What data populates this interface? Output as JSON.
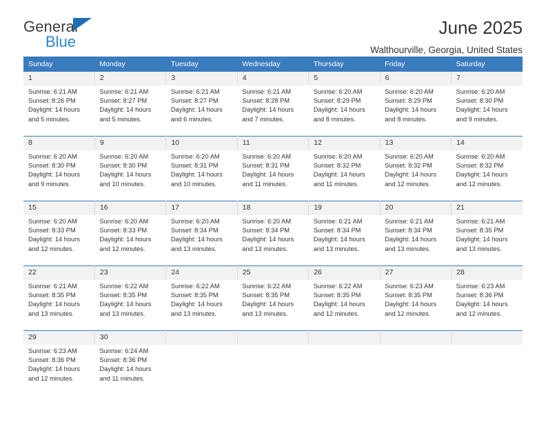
{
  "brand": {
    "word_one": "General",
    "word_two": "Blue",
    "triangle_color": "#1f6fb2",
    "blue_color": "#2b86cc"
  },
  "header": {
    "title": "June 2025",
    "subtitle": "Walthourville, Georgia, United States"
  },
  "theme": {
    "header_blue": "#3a7cbe",
    "daynum_bg": "#f2f2f2",
    "text": "#333333"
  },
  "calendar": {
    "weekday_headers": [
      "Sunday",
      "Monday",
      "Tuesday",
      "Wednesday",
      "Thursday",
      "Friday",
      "Saturday"
    ],
    "weeks": [
      [
        {
          "day": "1",
          "sunrise": "Sunrise: 6:21 AM",
          "sunset": "Sunset: 8:26 PM",
          "daylight_1": "Daylight: 14 hours",
          "daylight_2": "and 5 minutes."
        },
        {
          "day": "2",
          "sunrise": "Sunrise: 6:21 AM",
          "sunset": "Sunset: 8:27 PM",
          "daylight_1": "Daylight: 14 hours",
          "daylight_2": "and 5 minutes."
        },
        {
          "day": "3",
          "sunrise": "Sunrise: 6:21 AM",
          "sunset": "Sunset: 8:27 PM",
          "daylight_1": "Daylight: 14 hours",
          "daylight_2": "and 6 minutes."
        },
        {
          "day": "4",
          "sunrise": "Sunrise: 6:21 AM",
          "sunset": "Sunset: 8:28 PM",
          "daylight_1": "Daylight: 14 hours",
          "daylight_2": "and 7 minutes."
        },
        {
          "day": "5",
          "sunrise": "Sunrise: 6:20 AM",
          "sunset": "Sunset: 8:29 PM",
          "daylight_1": "Daylight: 14 hours",
          "daylight_2": "and 8 minutes."
        },
        {
          "day": "6",
          "sunrise": "Sunrise: 6:20 AM",
          "sunset": "Sunset: 8:29 PM",
          "daylight_1": "Daylight: 14 hours",
          "daylight_2": "and 8 minutes."
        },
        {
          "day": "7",
          "sunrise": "Sunrise: 6:20 AM",
          "sunset": "Sunset: 8:30 PM",
          "daylight_1": "Daylight: 14 hours",
          "daylight_2": "and 9 minutes."
        }
      ],
      [
        {
          "day": "8",
          "sunrise": "Sunrise: 6:20 AM",
          "sunset": "Sunset: 8:30 PM",
          "daylight_1": "Daylight: 14 hours",
          "daylight_2": "and 9 minutes."
        },
        {
          "day": "9",
          "sunrise": "Sunrise: 6:20 AM",
          "sunset": "Sunset: 8:30 PM",
          "daylight_1": "Daylight: 14 hours",
          "daylight_2": "and 10 minutes."
        },
        {
          "day": "10",
          "sunrise": "Sunrise: 6:20 AM",
          "sunset": "Sunset: 8:31 PM",
          "daylight_1": "Daylight: 14 hours",
          "daylight_2": "and 10 minutes."
        },
        {
          "day": "11",
          "sunrise": "Sunrise: 6:20 AM",
          "sunset": "Sunset: 8:31 PM",
          "daylight_1": "Daylight: 14 hours",
          "daylight_2": "and 11 minutes."
        },
        {
          "day": "12",
          "sunrise": "Sunrise: 6:20 AM",
          "sunset": "Sunset: 8:32 PM",
          "daylight_1": "Daylight: 14 hours",
          "daylight_2": "and 11 minutes."
        },
        {
          "day": "13",
          "sunrise": "Sunrise: 6:20 AM",
          "sunset": "Sunset: 8:32 PM",
          "daylight_1": "Daylight: 14 hours",
          "daylight_2": "and 12 minutes."
        },
        {
          "day": "14",
          "sunrise": "Sunrise: 6:20 AM",
          "sunset": "Sunset: 8:32 PM",
          "daylight_1": "Daylight: 14 hours",
          "daylight_2": "and 12 minutes."
        }
      ],
      [
        {
          "day": "15",
          "sunrise": "Sunrise: 6:20 AM",
          "sunset": "Sunset: 8:33 PM",
          "daylight_1": "Daylight: 14 hours",
          "daylight_2": "and 12 minutes."
        },
        {
          "day": "16",
          "sunrise": "Sunrise: 6:20 AM",
          "sunset": "Sunset: 8:33 PM",
          "daylight_1": "Daylight: 14 hours",
          "daylight_2": "and 12 minutes."
        },
        {
          "day": "17",
          "sunrise": "Sunrise: 6:20 AM",
          "sunset": "Sunset: 8:34 PM",
          "daylight_1": "Daylight: 14 hours",
          "daylight_2": "and 13 minutes."
        },
        {
          "day": "18",
          "sunrise": "Sunrise: 6:20 AM",
          "sunset": "Sunset: 8:34 PM",
          "daylight_1": "Daylight: 14 hours",
          "daylight_2": "and 13 minutes."
        },
        {
          "day": "19",
          "sunrise": "Sunrise: 6:21 AM",
          "sunset": "Sunset: 8:34 PM",
          "daylight_1": "Daylight: 14 hours",
          "daylight_2": "and 13 minutes."
        },
        {
          "day": "20",
          "sunrise": "Sunrise: 6:21 AM",
          "sunset": "Sunset: 8:34 PM",
          "daylight_1": "Daylight: 14 hours",
          "daylight_2": "and 13 minutes."
        },
        {
          "day": "21",
          "sunrise": "Sunrise: 6:21 AM",
          "sunset": "Sunset: 8:35 PM",
          "daylight_1": "Daylight: 14 hours",
          "daylight_2": "and 13 minutes."
        }
      ],
      [
        {
          "day": "22",
          "sunrise": "Sunrise: 6:21 AM",
          "sunset": "Sunset: 8:35 PM",
          "daylight_1": "Daylight: 14 hours",
          "daylight_2": "and 13 minutes."
        },
        {
          "day": "23",
          "sunrise": "Sunrise: 6:22 AM",
          "sunset": "Sunset: 8:35 PM",
          "daylight_1": "Daylight: 14 hours",
          "daylight_2": "and 13 minutes."
        },
        {
          "day": "24",
          "sunrise": "Sunrise: 6:22 AM",
          "sunset": "Sunset: 8:35 PM",
          "daylight_1": "Daylight: 14 hours",
          "daylight_2": "and 13 minutes."
        },
        {
          "day": "25",
          "sunrise": "Sunrise: 6:22 AM",
          "sunset": "Sunset: 8:35 PM",
          "daylight_1": "Daylight: 14 hours",
          "daylight_2": "and 13 minutes."
        },
        {
          "day": "26",
          "sunrise": "Sunrise: 6:22 AM",
          "sunset": "Sunset: 8:35 PM",
          "daylight_1": "Daylight: 14 hours",
          "daylight_2": "and 12 minutes."
        },
        {
          "day": "27",
          "sunrise": "Sunrise: 6:23 AM",
          "sunset": "Sunset: 8:35 PM",
          "daylight_1": "Daylight: 14 hours",
          "daylight_2": "and 12 minutes."
        },
        {
          "day": "28",
          "sunrise": "Sunrise: 6:23 AM",
          "sunset": "Sunset: 8:36 PM",
          "daylight_1": "Daylight: 14 hours",
          "daylight_2": "and 12 minutes."
        }
      ],
      [
        {
          "day": "29",
          "sunrise": "Sunrise: 6:23 AM",
          "sunset": "Sunset: 8:36 PM",
          "daylight_1": "Daylight: 14 hours",
          "daylight_2": "and 12 minutes."
        },
        {
          "day": "30",
          "sunrise": "Sunrise: 6:24 AM",
          "sunset": "Sunset: 8:36 PM",
          "daylight_1": "Daylight: 14 hours",
          "daylight_2": "and 11 minutes."
        },
        {
          "day": "",
          "sunrise": "",
          "sunset": "",
          "daylight_1": "",
          "daylight_2": ""
        },
        {
          "day": "",
          "sunrise": "",
          "sunset": "",
          "daylight_1": "",
          "daylight_2": ""
        },
        {
          "day": "",
          "sunrise": "",
          "sunset": "",
          "daylight_1": "",
          "daylight_2": ""
        },
        {
          "day": "",
          "sunrise": "",
          "sunset": "",
          "daylight_1": "",
          "daylight_2": ""
        },
        {
          "day": "",
          "sunrise": "",
          "sunset": "",
          "daylight_1": "",
          "daylight_2": ""
        }
      ]
    ]
  }
}
